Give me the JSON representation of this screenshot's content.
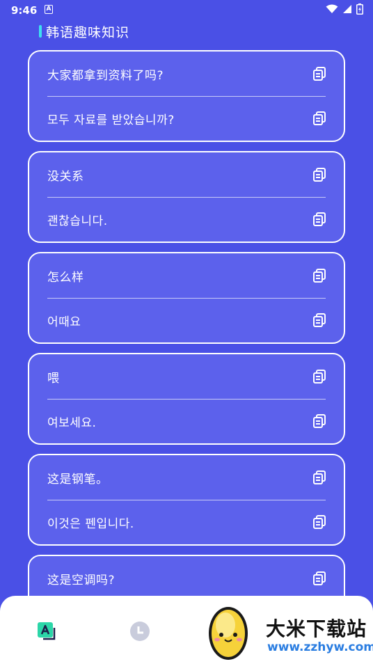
{
  "status_bar": {
    "time": "9:46",
    "notification_letter": "A"
  },
  "header": {
    "title": "韩语趣味知识",
    "accent_color": "#3ee0f0"
  },
  "theme": {
    "background": "#4a50e6",
    "card_background": "#5c61ec",
    "card_border": "#ffffff"
  },
  "cards": [
    {
      "chinese": "大家都拿到资料了吗?",
      "korean": "모두 자료를 받았습니까?"
    },
    {
      "chinese": "没关系",
      "korean": "괜찮습니다."
    },
    {
      "chinese": "怎么样",
      "korean": "어때요"
    },
    {
      "chinese": "喂",
      "korean": "여보세요."
    },
    {
      "chinese": "这是钢笔。",
      "korean": "이것은 펜입니다."
    },
    {
      "chinese": "这是空调吗?",
      "korean": ""
    }
  ],
  "bottom_nav": {
    "tabs": [
      {
        "icon": "translate-icon",
        "active": true
      },
      {
        "icon": "clock-icon",
        "active": false
      }
    ]
  },
  "watermark": {
    "title": "大米下载站",
    "url": "www.zzhyw.com"
  }
}
